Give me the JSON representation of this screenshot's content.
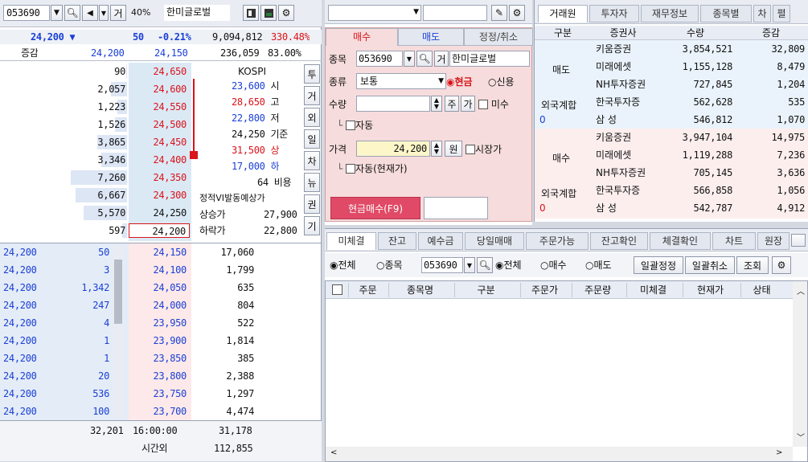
{
  "left_panel": {
    "code": "053690",
    "code_btn": "거",
    "ratio": "40%",
    "name": "한미글로벌",
    "summary": {
      "price": "24,200 ▼",
      "change": "50",
      "pct": "-0.21%",
      "volume": "9,094,812",
      "vol_ratio": "330.48%"
    },
    "row2": {
      "label": "증감",
      "sell_total": "24,200",
      "buy_total": "24,150",
      "amount": "236,059",
      "percent": "83.00%"
    },
    "asks": [
      {
        "qty": "90",
        "price": "24,650"
      },
      {
        "qty": "2,057",
        "price": "24,600"
      },
      {
        "qty": "1,223",
        "price": "24,550"
      },
      {
        "qty": "1,526",
        "price": "24,500"
      },
      {
        "qty": "3,865",
        "price": "24,450"
      },
      {
        "qty": "3,346",
        "price": "24,400"
      },
      {
        "qty": "7,260",
        "price": "24,350"
      },
      {
        "qty": "6,667",
        "price": "24,300"
      },
      {
        "qty": "5,570",
        "price": "24,250"
      },
      {
        "qty": "597",
        "price": "24,200"
      }
    ],
    "info": {
      "title": "KOSPI",
      "start": "23,600",
      "start_lbl": "시",
      "high": "28,650",
      "high_lbl": "고",
      "low": "22,800",
      "low_lbl": "저",
      "base": "24,250",
      "base_lbl": "기준",
      "upper": "31,500",
      "upper_lbl": "상",
      "lower": "17,000",
      "lower_lbl": "하",
      "cost": "64",
      "cost_lbl": "비용",
      "vi_label": "정적VI발동예상가",
      "vi_up_lbl": "상승가",
      "vi_up": "27,900",
      "vi_down_lbl": "하락가",
      "vi_down": "22,800"
    },
    "side_buttons": [
      "투",
      "거",
      "외",
      "일",
      "차",
      "뉴",
      "권",
      "기"
    ],
    "ticks": [
      {
        "price": "24,200",
        "qty": "50"
      },
      {
        "price": "24,200",
        "qty": "3"
      },
      {
        "price": "24,200",
        "qty": "1,342"
      },
      {
        "price": "24,200",
        "qty": "247"
      },
      {
        "price": "24,200",
        "qty": "4"
      },
      {
        "price": "24,200",
        "qty": "1"
      },
      {
        "price": "24,200",
        "qty": "1"
      },
      {
        "price": "24,200",
        "qty": "20"
      },
      {
        "price": "24,200",
        "qty": "536"
      },
      {
        "price": "24,200",
        "qty": "100"
      }
    ],
    "bids": [
      {
        "price": "24,150",
        "qty": "17,060"
      },
      {
        "price": "24,100",
        "qty": "1,799"
      },
      {
        "price": "24,050",
        "qty": "635"
      },
      {
        "price": "24,000",
        "qty": "804"
      },
      {
        "price": "23,950",
        "qty": "522"
      },
      {
        "price": "23,900",
        "qty": "1,814"
      },
      {
        "price": "23,850",
        "qty": "385"
      },
      {
        "price": "23,800",
        "qty": "2,388"
      },
      {
        "price": "23,750",
        "qty": "1,297"
      },
      {
        "price": "23,700",
        "qty": "4,474"
      }
    ],
    "footer": {
      "ask_total": "32,201",
      "time": "16:00:00",
      "bid_total": "31,178",
      "after_lbl": "시간외",
      "after_qty": "112,855"
    }
  },
  "order_panel": {
    "tabs": {
      "buy": "매수",
      "sell": "매도",
      "modify": "정정/취소"
    },
    "code_lbl": "종목",
    "code": "053690",
    "code_btn": "거",
    "name": "한미글로벌",
    "type_lbl": "종류",
    "type": "보통",
    "cash": "현금",
    "credit": "신용",
    "qty_lbl": "수량",
    "qty_btn1": "주",
    "qty_btn2": "가",
    "undecided": "미수",
    "auto": "자동",
    "price_lbl": "가격",
    "price": "24,200",
    "won": "원",
    "market": "시장가",
    "auto_cur": "자동(현재가)",
    "submit": "현금매수(F9)"
  },
  "broker": {
    "tabs": [
      "거래원",
      "투자자",
      "재무정보",
      "종목별",
      "차",
      "펼"
    ],
    "headers": [
      "구분",
      "증권사",
      "수량",
      "증감"
    ],
    "sell_lbl": "매도",
    "buy_lbl": "매수",
    "foreign_lbl": "외국계합",
    "zero": "0",
    "sell": [
      {
        "name": "키움증권",
        "qty": "3,854,521",
        "chg": "32,809"
      },
      {
        "name": "미래에셋",
        "qty": "1,155,128",
        "chg": "8,479"
      },
      {
        "name": "NH투자증권",
        "qty": "727,845",
        "chg": "1,204"
      },
      {
        "name": "한국투자증",
        "qty": "562,628",
        "chg": "535"
      },
      {
        "name": "삼 성",
        "qty": "546,812",
        "chg": "1,070"
      }
    ],
    "buy": [
      {
        "name": "키움증권",
        "qty": "3,947,104",
        "chg": "14,975"
      },
      {
        "name": "미래에셋",
        "qty": "1,119,288",
        "chg": "7,236"
      },
      {
        "name": "NH투자증권",
        "qty": "705,145",
        "chg": "3,636"
      },
      {
        "name": "한국투자증",
        "qty": "566,858",
        "chg": "1,056"
      },
      {
        "name": "삼 성",
        "qty": "542,787",
        "chg": "4,912"
      }
    ]
  },
  "bottom": {
    "tabs": [
      "미체결",
      "잔고",
      "예수금",
      "당일매매",
      "주문가능",
      "잔고확인",
      "체결확인",
      "차트",
      "원장"
    ],
    "filter": {
      "all": "전체",
      "stock": "종목",
      "code": "053690",
      "all2": "전체",
      "buy": "매수",
      "sell": "매도",
      "bulk_modify": "일괄정정",
      "bulk_cancel": "일괄취소",
      "query": "조회"
    },
    "columns": [
      "주문",
      "종목명",
      "구분",
      "주문가",
      "주문량",
      "미체결",
      "현재가",
      "상태"
    ]
  },
  "colors": {
    "red": "#d9141a",
    "blue": "#1a3fd6",
    "ask_bg": "#dbe9f5",
    "bid_bg": "#fbe3e3",
    "order_bg": "#f6dcdc"
  }
}
